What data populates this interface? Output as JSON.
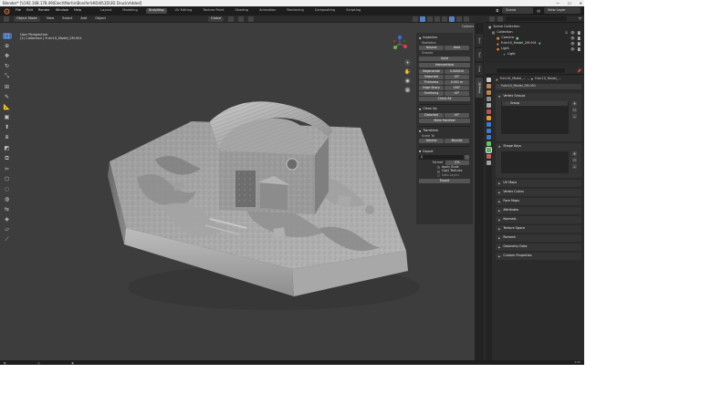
{
  "title_bar": {
    "title": "Blender* [\\\\192.168.178.49\\Elect\\Martin\\Bonifer\\HID40\\3D\\3D Druck\\Added]",
    "minimize": "—",
    "maximize": "☐",
    "close": "✕"
  },
  "menu": [
    "File",
    "Edit",
    "Render",
    "Window",
    "Help"
  ],
  "workspaces": [
    {
      "label": "Layout",
      "active": false
    },
    {
      "label": "Modeling",
      "active": false
    },
    {
      "label": "Sculpting",
      "active": true
    },
    {
      "label": "UV Editing",
      "active": false
    },
    {
      "label": "Texture Paint",
      "active": false
    },
    {
      "label": "Shading",
      "active": false
    },
    {
      "label": "Animation",
      "active": false
    },
    {
      "label": "Rendering",
      "active": false
    },
    {
      "label": "Compositing",
      "active": false
    },
    {
      "label": "Scripting",
      "active": false
    }
  ],
  "top_right": {
    "scene_label": "Scene",
    "view_layer_label": "View Layer"
  },
  "header": {
    "mode": "Object Mode",
    "menus": [
      "View",
      "Select",
      "Add",
      "Object"
    ],
    "orientation": "Global",
    "options": "Options"
  },
  "viewport": {
    "view_name": "User Perspective",
    "collection_info": "(1) Collection | Fuhr10_Model_2M.001"
  },
  "npanel": {
    "title": "Inpsector",
    "statistics_label": "Statistics",
    "volume": "Volume",
    "area": "Area",
    "checks_label": "Checks",
    "solid": "Solid",
    "intersections": "Intersections",
    "degenerate_label": "Degenerate",
    "degenerate_value": "0.000010",
    "distorted_label": "Distorted",
    "distorted_value": "45°",
    "thickness_label": "Thickness",
    "thickness_value": "0.001 m",
    "edge_sharp_label": "Edge Sharp",
    "edge_sharp_value": "160°",
    "overhang_label": "Overhang",
    "overhang_value": "45°",
    "check_all": "Check All",
    "cleanup_title": "Clean Up",
    "cleanup_distorted": "Distorted",
    "cleanup_distorted_value": "45°",
    "make_manifold": "Make Manifold",
    "transform_title": "Transform",
    "scale_to": "Scale To",
    "scale_volume": "Volume",
    "scale_bounds": "Bounds",
    "export_title": "Export",
    "export_path": "//",
    "format_label": "Format",
    "format_value": "STL",
    "apply_scale": "Apply Scale",
    "copy_textures": "Copy Textures",
    "data_layers": "Data Layers",
    "export_button": "Export"
  },
  "side_tabs": [
    "Item",
    "Tool",
    "View",
    "3D-Print"
  ],
  "outliner": {
    "search_placeholder": "",
    "rows": [
      {
        "label": "Scene Collection",
        "indent": 0,
        "selected": false
      },
      {
        "label": "Collection",
        "indent": 1,
        "selected": false
      },
      {
        "label": "Camera",
        "indent": 2,
        "selected": false
      },
      {
        "label": "Fuhr10_Model_2M.001",
        "indent": 2,
        "selected": false
      },
      {
        "label": "Light",
        "indent": 2,
        "selected": false
      },
      {
        "label": "Light",
        "indent": 3,
        "selected": false
      }
    ]
  },
  "properties": {
    "breadcrumb_object": "Fuhr10_Model_...",
    "breadcrumb_mesh": "Fuhr10_Model_...",
    "mesh_name": "Fuhr10_Model_2M.001",
    "vertex_groups_title": "Vertex Groups",
    "group_item": "Group",
    "shape_keys_title": "Shape Keys",
    "panels": [
      "UV Maps",
      "Vertex Colors",
      "Face Maps",
      "Attributes",
      "Normals",
      "Texture Space",
      "Remesh",
      "Geometry Data",
      "Custom Properties"
    ]
  },
  "statusbar": {
    "items": [
      "",
      "",
      "",
      "",
      ""
    ],
    "version": "2.93"
  },
  "colors": {
    "accent": "#4772b3",
    "viewport_bg": "#3d3d3d",
    "panel_bg": "#303030"
  }
}
